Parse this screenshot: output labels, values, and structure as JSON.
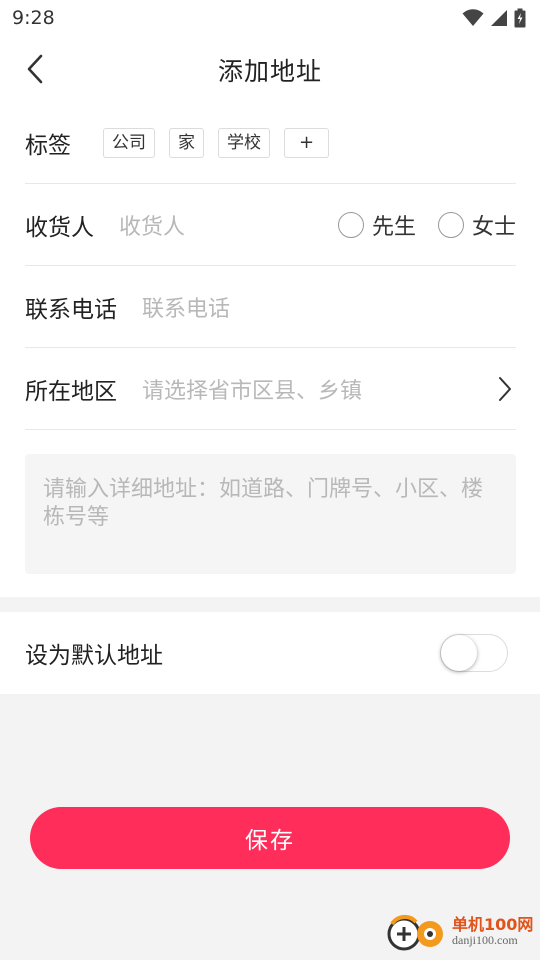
{
  "status_bar": {
    "time": "9:28"
  },
  "nav": {
    "title": "添加地址"
  },
  "form": {
    "tag_label": "标签",
    "tags": [
      "公司",
      "家",
      "学校"
    ],
    "tag_add": "+",
    "recipient_label": "收货人",
    "recipient_placeholder": "收货人",
    "gender_options": [
      "先生",
      "女士"
    ],
    "phone_label": "联系电话",
    "phone_placeholder": "联系电话",
    "region_label": "所在地区",
    "region_placeholder": "请选择省市区县、乡镇",
    "detail_placeholder": "请输入详细地址：如道路、门牌号、小区、楼栋号等"
  },
  "default_address": {
    "label": "设为默认地址",
    "enabled": false
  },
  "save_label": "保存",
  "watermark": {
    "cn": "单机100网",
    "en": "danji100.com"
  },
  "colors": {
    "accent": "#ff2d5a",
    "placeholder": "#b8b8b8",
    "background": "#f3f3f3"
  },
  "icons": [
    "wifi-icon",
    "signal-icon",
    "battery-icon",
    "back-arrow-icon",
    "chevron-right-icon"
  ]
}
